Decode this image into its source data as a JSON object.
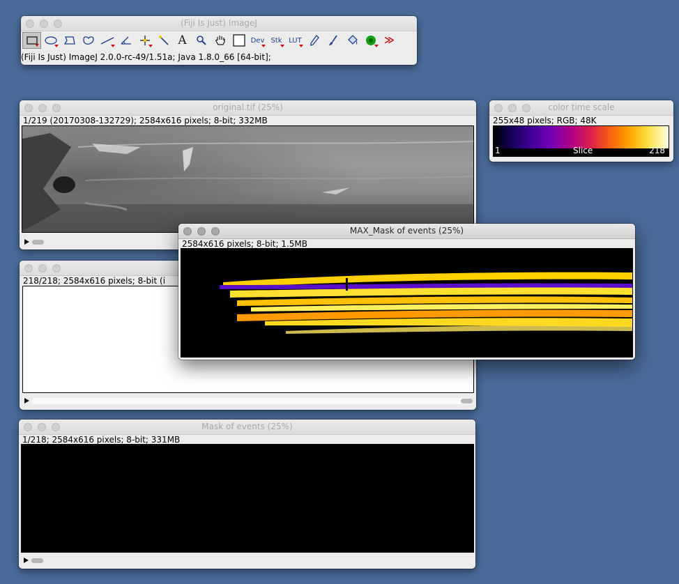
{
  "toolbar": {
    "title": "(Fiji Is Just) ImageJ",
    "status": "(Fiji Is Just) ImageJ 2.0.0-rc-49/1.51a; Java 1.8.0_66 [64-bit];",
    "tools": [
      {
        "name": "rectangle-tool",
        "label": ""
      },
      {
        "name": "oval-tool",
        "label": ""
      },
      {
        "name": "polygon-tool",
        "label": ""
      },
      {
        "name": "freehand-tool",
        "label": ""
      },
      {
        "name": "line-tool",
        "label": ""
      },
      {
        "name": "angle-tool",
        "label": ""
      },
      {
        "name": "point-tool",
        "label": ""
      },
      {
        "name": "wand-tool",
        "label": ""
      },
      {
        "name": "text-tool",
        "label": "A"
      },
      {
        "name": "magnifier-tool",
        "label": ""
      },
      {
        "name": "hand-tool",
        "label": ""
      },
      {
        "name": "color-picker-tool",
        "label": ""
      },
      {
        "name": "dev-menu-button",
        "label": "Dev"
      },
      {
        "name": "stk-menu-button",
        "label": "Stk"
      },
      {
        "name": "lut-menu-button",
        "label": "LUT"
      },
      {
        "name": "pencil-tool",
        "label": ""
      },
      {
        "name": "brush-tool",
        "label": ""
      },
      {
        "name": "flood-fill-tool",
        "label": ""
      },
      {
        "name": "green-blob-tool",
        "label": ""
      },
      {
        "name": "more-tools-button",
        "label": "≫"
      }
    ]
  },
  "windows": {
    "original": {
      "title": "original.tif (25%)",
      "info": "1/219 (20170308-132729); 2584x616 pixels; 8-bit; 332MB",
      "slider_position": 0.0
    },
    "blank": {
      "title": "",
      "info": "218/218; 2584x616 pixels; 8-bit (i",
      "slider_position": 1.0
    },
    "mask": {
      "title": "Mask of events (25%)",
      "info": "1/218; 2584x616 pixels; 8-bit; 331MB",
      "slider_position": 0.0
    },
    "color_scale": {
      "title": "color time scale",
      "info": "255x48 pixels; RGB; 48K",
      "min_label": "1",
      "center_label": "Slice",
      "max_label": "218"
    },
    "max_mask": {
      "title": "MAX_Mask of events (25%)",
      "info": "2584x616 pixels; 8-bit; 1.5MB"
    }
  },
  "colors": {
    "desktop": "#4a6b9a",
    "lut_low": "#3a0090",
    "lut_high": "#ffe040"
  }
}
